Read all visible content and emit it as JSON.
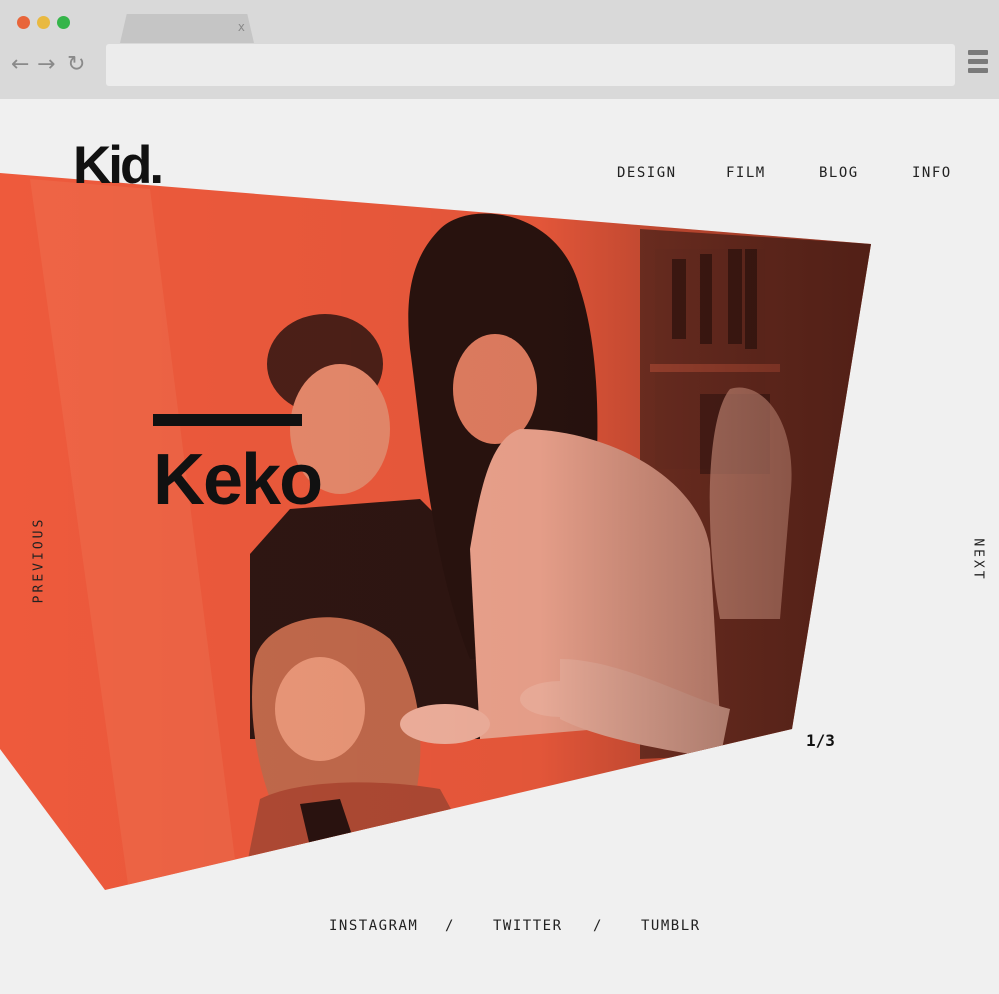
{
  "browser": {
    "tab_close": "x",
    "icons": [
      "back-arrow-icon",
      "forward-arrow-icon",
      "reload-icon",
      "hamburger-menu-icon"
    ]
  },
  "site": {
    "logo": "Kid.",
    "nav": [
      "DESIGN",
      "FILM",
      "BLOG",
      "INFO"
    ],
    "project_title": "Keko",
    "previous_label": "PREVIOUS",
    "next_label": "NEXT",
    "counter": "1/3",
    "social": [
      "INSTAGRAM",
      "/",
      "TWITTER",
      "/",
      "TUMBLR"
    ]
  },
  "colors": {
    "photo_tint": "#ee5a3c",
    "text": "#111111",
    "page_bg": "#f0f0f0"
  }
}
